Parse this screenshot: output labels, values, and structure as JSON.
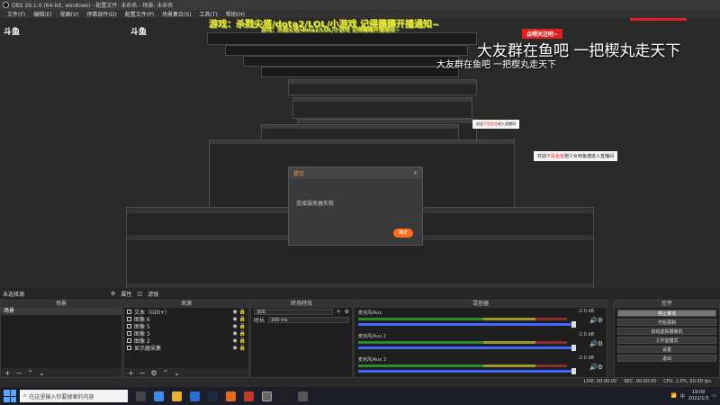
{
  "window": {
    "title": "OBS 26.1.0 (64-bit, windows) - 配置文件: 未命名 - 场景: 未命名"
  },
  "menu": [
    "文件(F)",
    "编辑(E)",
    "视图(V)",
    "停靠部件(D)",
    "配置文件(P)",
    "场景集合(S)",
    "工具(T)",
    "帮助(H)"
  ],
  "overlay": {
    "banner_game": "游戏：杀戮尖塔/dota2/LOL/小游戏 记得薅薅开播通知~",
    "banner_follow": "点喂关注吧~",
    "big_text": "大友群在鱼吧 一把楔丸走天下",
    "toast_welcome": {
      "pre": "欢迎",
      "name": "不是鱼鱼",
      "post": "陪少女到鱼塘进入直播间"
    },
    "toast_welcome_small": {
      "pre": "欢迎",
      "name": "不是鱼鱼",
      "post": "进入直播间"
    }
  },
  "dialog": {
    "title": "提示",
    "message": "连接服务器失败",
    "button": "确定"
  },
  "dock": {
    "scene_label": "未选择源",
    "props": "属性",
    "filters": "滤镜"
  },
  "panels": {
    "scenes": {
      "title": "场景",
      "items": [
        "场景"
      ]
    },
    "sources": {
      "title": "来源",
      "items": [
        "文本（GDI+）",
        "图像 6",
        "图像 5",
        "图像 3",
        "图像 2",
        "显示器采集"
      ]
    },
    "transitions": {
      "title": "转场特效",
      "type": "淡出",
      "duration_label": "时长",
      "duration_value": "300 ms"
    },
    "mixer": {
      "title": "混音器",
      "tracks": [
        {
          "name": "麦克风/Aux",
          "db": "-2.0 dB"
        },
        {
          "name": "麦克风/Aux 2",
          "db": "-2.0 dB"
        },
        {
          "name": "麦克风/Aux 3",
          "db": "-2.0 dB"
        }
      ]
    },
    "controls": {
      "title": "控件",
      "buttons": [
        "停止推流",
        "开始录制",
        "启动虚拟摄像机",
        "工作室模式",
        "设置",
        "退出"
      ]
    }
  },
  "status": {
    "live": "LIVE: 00:00:00",
    "rec": "REC: 00:00:00",
    "cpu": "CPU: 1.0%, 60.00 fps"
  },
  "taskbar": {
    "search_placeholder": "在这里输入你要搜索的内容",
    "time": "19:09",
    "date": "2022/1/3",
    "ime": "中"
  },
  "colors": {
    "accent": "#3f66ff",
    "orange": "#ff6a1a",
    "yellow": "#f4e43a",
    "red": "#e02020"
  }
}
